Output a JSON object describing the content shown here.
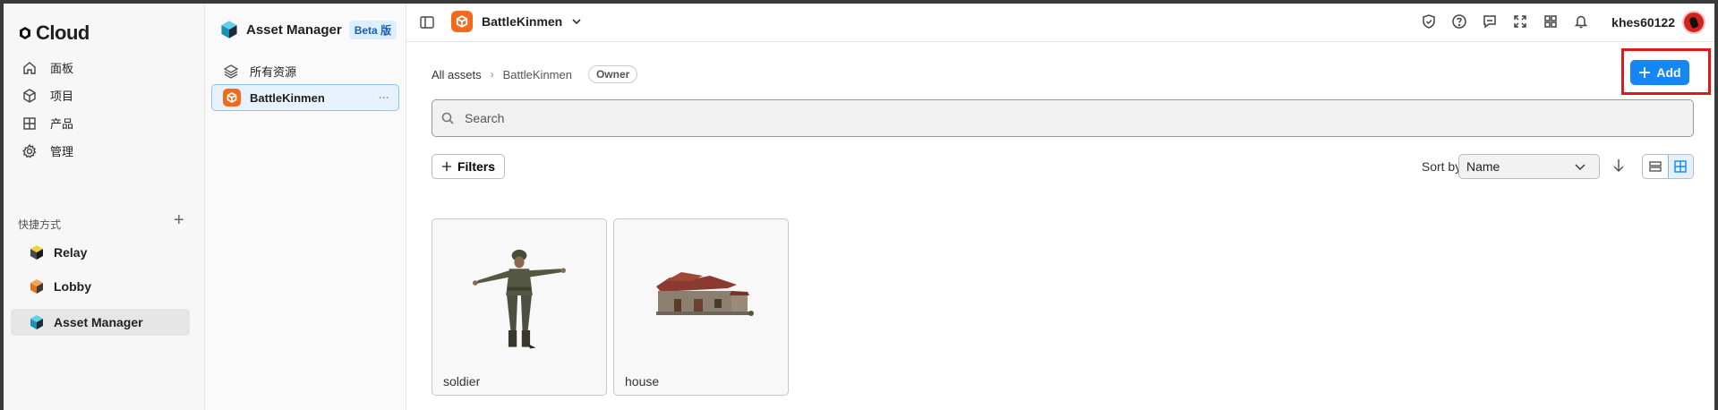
{
  "app": {
    "logo": "Cloud"
  },
  "nav": {
    "items": [
      {
        "label": "面板",
        "icon": "home-icon"
      },
      {
        "label": "项目",
        "icon": "cube-icon"
      },
      {
        "label": "产品",
        "icon": "grid-icon"
      },
      {
        "label": "管理",
        "icon": "gear-icon"
      }
    ]
  },
  "shortcuts": {
    "title": "快捷方式",
    "items": [
      {
        "label": "Relay"
      },
      {
        "label": "Lobby"
      },
      {
        "label": "Asset Manager",
        "active": true
      }
    ]
  },
  "asset_manager": {
    "title": "Asset Manager",
    "badge": "Beta 版",
    "all_resources": "所有资源",
    "project": "BattleKinmen",
    "project_more": "···"
  },
  "topbar": {
    "project": "BattleKinmen",
    "icons": [
      "shield-check-icon",
      "help-icon",
      "feedback-icon",
      "fullscreen-icon",
      "apps-icon",
      "bell-icon"
    ],
    "username": "khes60122"
  },
  "main": {
    "breadcrumb": {
      "root": "All assets",
      "current": "BattleKinmen",
      "role": "Owner"
    },
    "add_label": "Add",
    "search_placeholder": "Search",
    "filters_label": "Filters",
    "sort_label": "Sort by :",
    "sort_value": "Name",
    "assets": [
      {
        "name": "soldier"
      },
      {
        "name": "house"
      }
    ]
  },
  "colors": {
    "accent": "#1487f5",
    "project_icon": "#f26b1d",
    "highlight": "#e0181b"
  }
}
